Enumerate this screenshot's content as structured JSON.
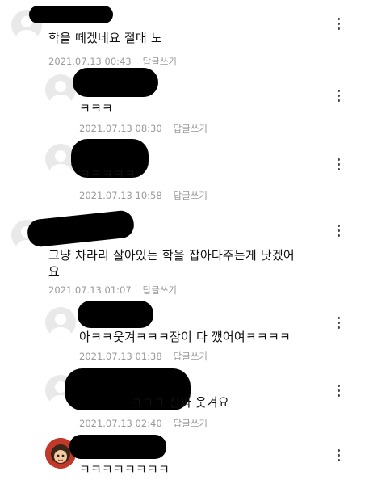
{
  "comments": [
    {
      "text": "학을 떼겠네요 절대 노",
      "date": "2021.07.13 00:43",
      "reply": "답글쓰기"
    },
    {
      "text": "ㅋㅋㅋ",
      "date": "2021.07.13 08:30",
      "reply": "답글쓰기"
    },
    {
      "text": "ㅋㅋㅋㅋㅋ",
      "date": "2021.07.13 10:58",
      "reply": "답글쓰기"
    },
    {
      "text": "그냥 차라리 살아있는 학을 잡아다주는게 낫겠어\n요",
      "date": "2021.07.13 01:07",
      "reply": "답글쓰기"
    },
    {
      "text": "아ㅋㅋ웃겨ㅋㅋㅋ잠이 다 깼어여ㅋㅋㅋㅋ",
      "date": "2021.07.13 01:38",
      "reply": "답글쓰기"
    },
    {
      "text": "ㅋㅋㅋ 신짜 웃겨요",
      "date": "2021.07.13 02:40",
      "reply": "답글쓰기"
    },
    {
      "text": "ㅋㅋㅋㅋㅋㅋㅋㅋ",
      "date": "",
      "reply": ""
    }
  ],
  "icons": {
    "avatar": "default-avatar-icon",
    "profile": "profile-photo-icon",
    "more": "more-vertical-icon"
  },
  "colors": {
    "meta_text": "#9a9a9a",
    "redaction": "#000000"
  }
}
